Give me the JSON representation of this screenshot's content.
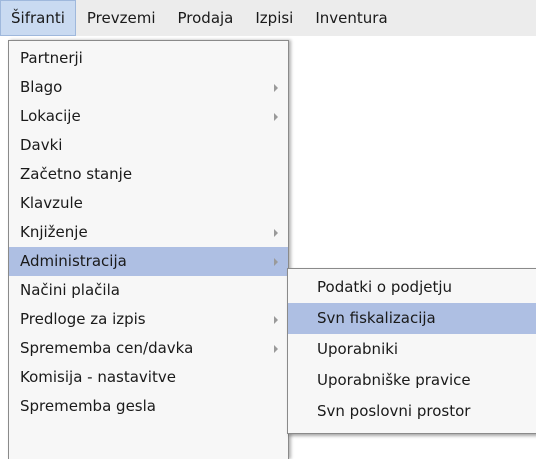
{
  "menubar": {
    "items": [
      "Šifranti",
      "Prevzemi",
      "Prodaja",
      "Izpisi",
      "Inventura"
    ]
  },
  "main_menu": {
    "items": [
      {
        "label": "Partnerji",
        "submenu": false
      },
      {
        "label": "Blago",
        "submenu": true
      },
      {
        "label": "Lokacije",
        "submenu": true
      },
      {
        "label": "Davki",
        "submenu": false
      },
      {
        "label": "Začetno stanje",
        "submenu": false
      },
      {
        "label": "Klavzule",
        "submenu": false
      },
      {
        "label": "Knjiženje",
        "submenu": true
      },
      {
        "label": "Administracija",
        "submenu": true
      },
      {
        "label": "Načini plačila",
        "submenu": false
      },
      {
        "label": "Predloge za izpis",
        "submenu": true
      },
      {
        "label": "Sprememba cen/davka",
        "submenu": true
      },
      {
        "label": "Komisija - nastavitve",
        "submenu": false
      },
      {
        "label": "Sprememba gesla",
        "submenu": false
      }
    ]
  },
  "sub_menu": {
    "items": [
      "Podatki o podjetju",
      "Svn fiskalizacija",
      "Uporabniki",
      "Uporabniške pravice",
      "Svn poslovni prostor"
    ]
  },
  "colors": {
    "active_item": "#aebfe3",
    "menubar_active": "#c9daf1",
    "menu_background": "#f7f7f7"
  }
}
